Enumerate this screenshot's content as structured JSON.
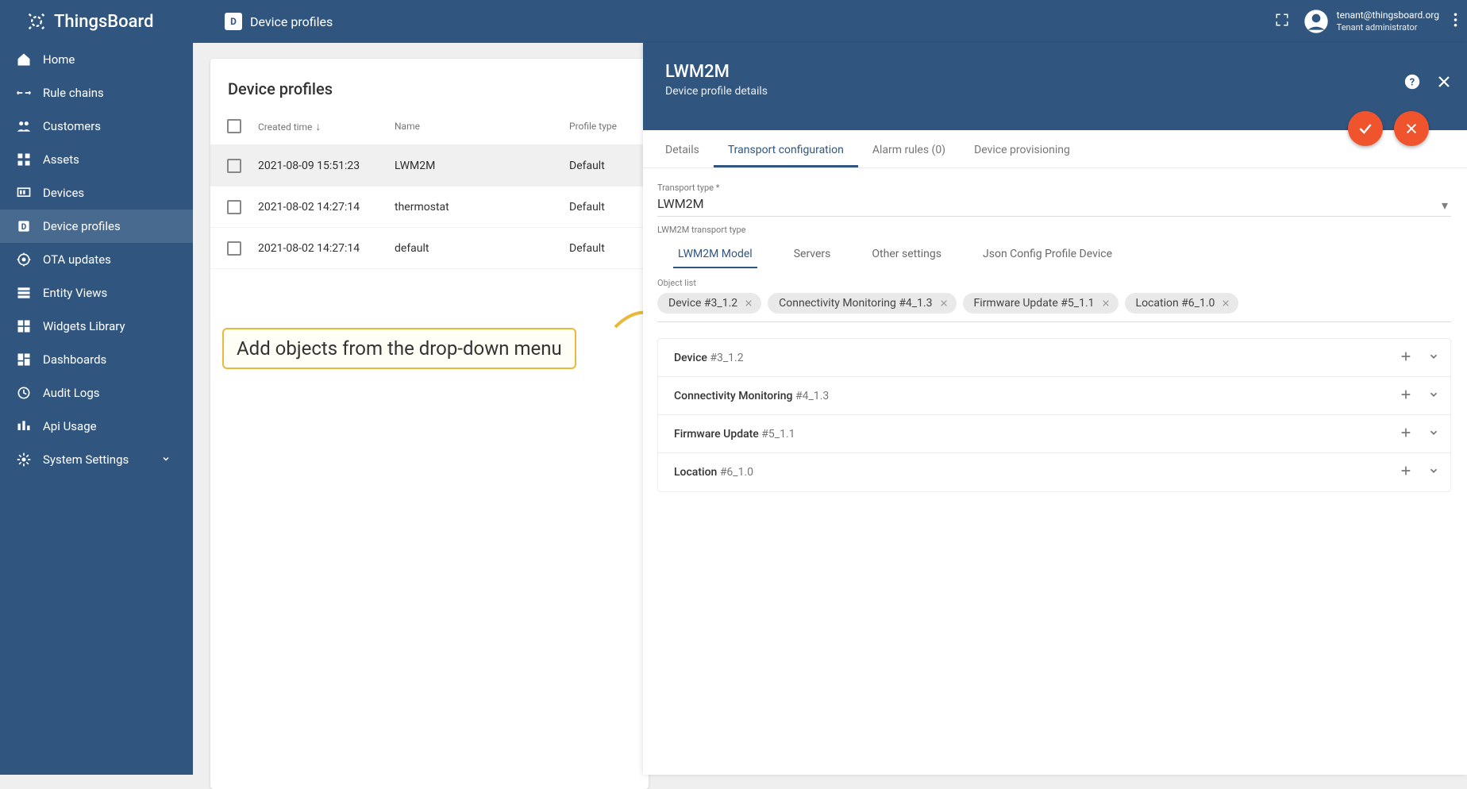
{
  "app": {
    "name": "ThingsBoard"
  },
  "breadcrumb": {
    "icon_letter": "D",
    "label": "Device profiles"
  },
  "user": {
    "email": "tenant@thingsboard.org",
    "role": "Tenant administrator"
  },
  "sidebar": {
    "items": [
      {
        "icon": "home",
        "label": "Home"
      },
      {
        "icon": "rules",
        "label": "Rule chains"
      },
      {
        "icon": "customers",
        "label": "Customers"
      },
      {
        "icon": "assets",
        "label": "Assets"
      },
      {
        "icon": "devices",
        "label": "Devices"
      },
      {
        "icon": "profiles",
        "label": "Device profiles"
      },
      {
        "icon": "ota",
        "label": "OTA updates"
      },
      {
        "icon": "entity",
        "label": "Entity Views"
      },
      {
        "icon": "widgets",
        "label": "Widgets Library"
      },
      {
        "icon": "dashboards",
        "label": "Dashboards"
      },
      {
        "icon": "audit",
        "label": "Audit Logs"
      },
      {
        "icon": "api",
        "label": "Api Usage"
      },
      {
        "icon": "settings",
        "label": "System Settings"
      }
    ],
    "active_index": 5
  },
  "table": {
    "title": "Device profiles",
    "columns": {
      "time": "Created time",
      "name": "Name",
      "type": "Profile type"
    },
    "rows": [
      {
        "time": "2021-08-09 15:51:23",
        "name": "LWM2M",
        "type": "Default",
        "selected": true
      },
      {
        "time": "2021-08-02 14:27:14",
        "name": "thermostat",
        "type": "Default",
        "selected": false
      },
      {
        "time": "2021-08-02 14:27:14",
        "name": "default",
        "type": "Default",
        "selected": false
      }
    ]
  },
  "annotation": {
    "text": "Add objects from the drop-down menu"
  },
  "panel": {
    "title": "LWM2M",
    "subtitle": "Device profile details",
    "tabs": [
      {
        "label": "Details"
      },
      {
        "label": "Transport configuration"
      },
      {
        "label": "Alarm rules (0)"
      },
      {
        "label": "Device provisioning"
      }
    ],
    "active_tab": 1,
    "transport_type_label": "Transport type *",
    "transport_type_value": "LWM2M",
    "sub_label": "LWM2M transport type",
    "sub_tabs": [
      {
        "label": "LWM2M Model"
      },
      {
        "label": "Servers"
      },
      {
        "label": "Other settings"
      },
      {
        "label": "Json Config Profile Device"
      }
    ],
    "active_sub_tab": 0,
    "object_list_label": "Object list",
    "chips": [
      {
        "label": "Device #3_1.2"
      },
      {
        "label": "Connectivity Monitoring #4_1.3"
      },
      {
        "label": "Firmware Update #5_1.1"
      },
      {
        "label": "Location #6_1.0"
      }
    ],
    "objects": [
      {
        "name": "Device",
        "id": "#3_1.2"
      },
      {
        "name": "Connectivity Monitoring",
        "id": "#4_1.3"
      },
      {
        "name": "Firmware Update",
        "id": "#5_1.1"
      },
      {
        "name": "Location",
        "id": "#6_1.0"
      }
    ]
  }
}
